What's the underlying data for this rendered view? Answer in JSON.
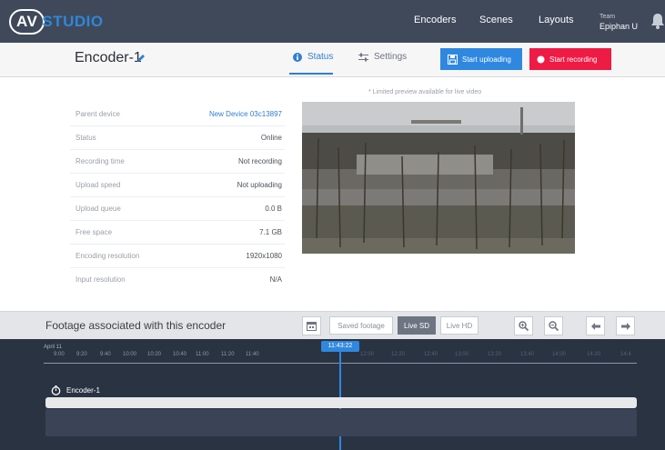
{
  "topbar": {
    "logo_av": "AV",
    "logo_studio": "STUDIO",
    "nav": [
      "Encoders",
      "Scenes",
      "Layouts"
    ],
    "team_label": "Team",
    "team_name": "Epiphan U"
  },
  "header": {
    "encoder_name": "Encoder-1",
    "tab_status": "Status",
    "tab_settings": "Settings",
    "upload_label": "Start uploading",
    "record_label": "Start recording"
  },
  "info": [
    {
      "key": "Parent device",
      "value": "New Device 03c13897"
    },
    {
      "key": "Status",
      "value": "Online"
    },
    {
      "key": "Recording time",
      "value": "Not recording"
    },
    {
      "key": "Upload speed",
      "value": "Not uploading"
    },
    {
      "key": "Upload queue",
      "value": "0.0 B"
    },
    {
      "key": "Free space",
      "value": "7.1 GB"
    },
    {
      "key": "Encoding resolution",
      "value": "1920x1080"
    },
    {
      "key": "Input resolution",
      "value": "N/A"
    }
  ],
  "preview_note": "* Limited preview available for live video",
  "footage": {
    "title": "Footage associated with this encoder",
    "saved_label": "Saved footage",
    "live_sd_label": "Live SD",
    "live_hd_label": "Live HD"
  },
  "timeline": {
    "date": "April 11",
    "ticks": [
      "9:00",
      "9:20",
      "9:40",
      "10:00",
      "10:20",
      "10:40",
      "11:00",
      "11:20",
      "11:40",
      "12:00",
      "12:20",
      "12:40",
      "13:00",
      "13:20",
      "13:40",
      "14:00",
      "14:20",
      "14:4"
    ],
    "cursor_time": "11:43:22",
    "track_name": "Encoder-1"
  },
  "colors": {
    "topbar": "#3f495a",
    "accent_blue": "#2f88e0",
    "record_red": "#ee1b44",
    "timeline_bg": "#2a3342"
  }
}
